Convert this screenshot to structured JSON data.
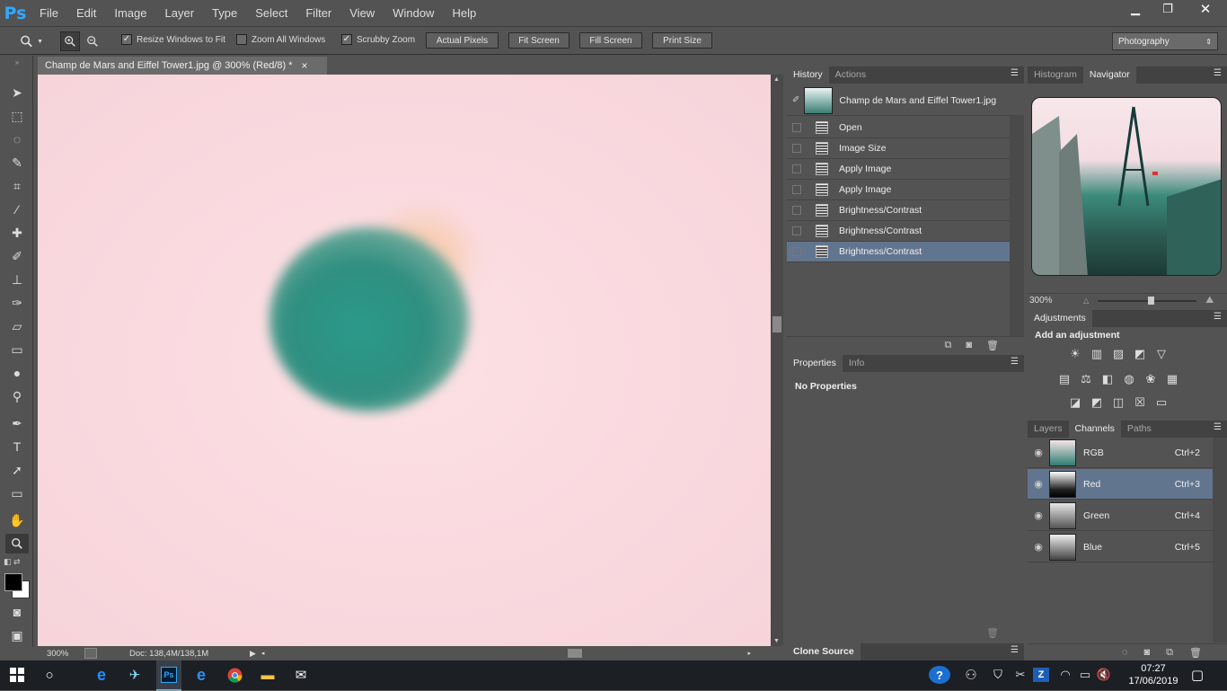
{
  "app": {
    "logo": "Ps"
  },
  "menu": [
    "File",
    "Edit",
    "Image",
    "Layer",
    "Type",
    "Select",
    "Filter",
    "View",
    "Window",
    "Help"
  ],
  "window_controls": {
    "minimize": "▁",
    "restore": "❐",
    "close": "✕"
  },
  "options": {
    "resize_windows": "Resize Windows to Fit",
    "zoom_all": "Zoom All Windows",
    "scrubby": "Scrubby Zoom",
    "actual_pixels": "Actual Pixels",
    "fit_screen": "Fit Screen",
    "fill_screen": "Fill Screen",
    "print_size": "Print Size",
    "workspace": "Photography",
    "resize_checked": true,
    "zoom_all_checked": false,
    "scrubby_checked": true
  },
  "document": {
    "tab_title": "Champ de Mars and Eiffel Tower1.jpg @ 300%  (Red/8) *",
    "close": "×",
    "zoom": "300%",
    "doc_info": "Doc: 138,4M/138,1M"
  },
  "history": {
    "tabs": [
      "History",
      "Actions"
    ],
    "snapshot": "Champ de Mars and Eiffel Tower1.jpg",
    "items": [
      "Open",
      "Image Size",
      "Apply Image",
      "Apply Image",
      "Brightness/Contrast",
      "Brightness/Contrast",
      "Brightness/Contrast"
    ],
    "selected_index": 6
  },
  "properties": {
    "tabs": [
      "Properties",
      "Info"
    ],
    "body": "No Properties"
  },
  "clone_source": {
    "title": "Clone Source"
  },
  "navigator": {
    "tabs": [
      "Histogram",
      "Navigator"
    ],
    "zoom": "300%"
  },
  "adjustments": {
    "title": "Adjustments",
    "subtitle": "Add an adjustment"
  },
  "channels": {
    "tabs": [
      "Layers",
      "Channels",
      "Paths"
    ],
    "items": [
      {
        "name": "RGB",
        "shortcut": "Ctrl+2"
      },
      {
        "name": "Red",
        "shortcut": "Ctrl+3"
      },
      {
        "name": "Green",
        "shortcut": "Ctrl+4"
      },
      {
        "name": "Blue",
        "shortcut": "Ctrl+5"
      }
    ],
    "selected_index": 1
  },
  "taskbar": {
    "time": "07:27",
    "date": "17/06/2019"
  },
  "colors": {
    "accent": "#31a8ff",
    "selection": "#62758f"
  }
}
